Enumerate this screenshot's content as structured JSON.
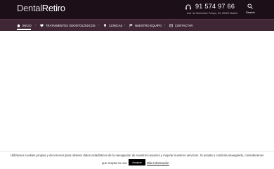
{
  "header": {
    "logo_part1": "Dental",
    "logo_part2": "Retiro",
    "phone": "91 574 97 66",
    "address": "Avd. de Menéndez Pelayo, 63, 28009 Madrid",
    "search_label": "Search",
    "phone_icon": "headset-icon",
    "search_icon": "search-icon"
  },
  "nav": {
    "items": [
      {
        "label": "Inicio",
        "icon": "home-icon",
        "active": true
      },
      {
        "label": "Tratamientos odontológicos",
        "icon": "heart-icon"
      },
      {
        "label": "Clínicas",
        "icon": "location-pin-icon"
      },
      {
        "label": "Nuestro equipo",
        "icon": "flag-icon"
      },
      {
        "label": "Contactar",
        "icon": "envelope-icon"
      }
    ]
  },
  "cookie": {
    "text_line1": "Utilizamos cookies propias y de terceros para obtener datos estadísticos de la navegación de nuestros usuarios y mejorar nuestros servicios. Si acepta o continúa navegando, consideramos",
    "text_line2": "que acepta su uso.",
    "accept_label": "Aceptar",
    "more_info_label": "Más Información"
  },
  "colors": {
    "header_bg": "#1c0f18",
    "nav_bg": "#3f2736",
    "accent": "#ffffff"
  }
}
